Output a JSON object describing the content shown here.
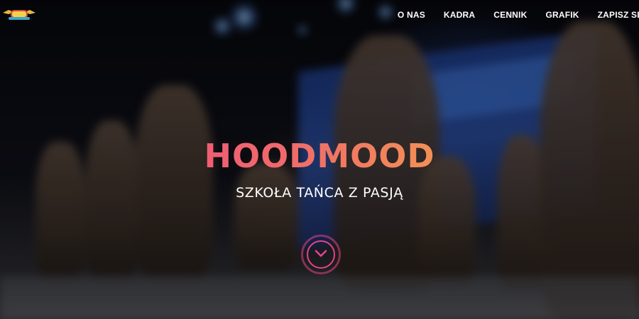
{
  "brand": {
    "logo_icon": "hoodmood-logo-icon",
    "colors": {
      "gradient_start": "#ec3f86",
      "gradient_end": "#f5c23a",
      "accent": "#e0458a"
    }
  },
  "nav": {
    "items": [
      {
        "label": "O NAS"
      },
      {
        "label": "KADRA"
      },
      {
        "label": "CENNIK"
      },
      {
        "label": "GRAFIK"
      },
      {
        "label": "ZAPISZ SIĘ"
      }
    ]
  },
  "hero": {
    "title": "HOODMOOD",
    "subtitle": "SZKOŁA TAŃCA Z PASJĄ",
    "scroll_icon": "chevron-down-icon",
    "background_icon": "dance-performance-photo"
  }
}
